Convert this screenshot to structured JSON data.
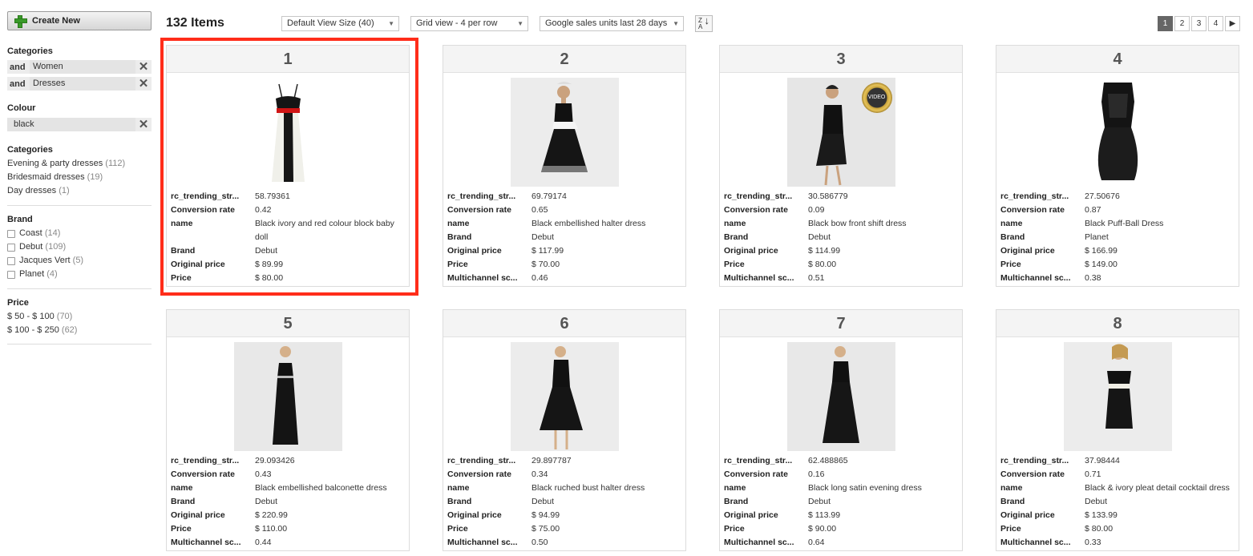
{
  "sidebar": {
    "create_label": "Create New",
    "applied_categories_title": "Categories",
    "applied_categories": [
      {
        "op": "and",
        "value": "Women"
      },
      {
        "op": "and",
        "value": "Dresses"
      }
    ],
    "colour_title": "Colour",
    "colour_value": "black",
    "categories_title": "Categories",
    "categories": [
      {
        "label": "Evening & party dresses",
        "count": "(112)"
      },
      {
        "label": "Bridesmaid dresses",
        "count": "(19)"
      },
      {
        "label": "Day dresses",
        "count": "(1)"
      }
    ],
    "brand_title": "Brand",
    "brands": [
      {
        "label": "Coast",
        "count": "(14)"
      },
      {
        "label": "Debut",
        "count": "(109)"
      },
      {
        "label": "Jacques Vert",
        "count": "(5)"
      },
      {
        "label": "Planet",
        "count": "(4)"
      }
    ],
    "price_title": "Price",
    "prices": [
      {
        "label": "$ 50 - $ 100",
        "count": "(70)"
      },
      {
        "label": "$ 100 - $ 250",
        "count": "(62)"
      }
    ]
  },
  "toolbar": {
    "items_count": "132 Items",
    "view_size": "Default View Size (40)",
    "grid_view": "Grid view - 4 per row",
    "sort_by": "Google sales units last 28 days",
    "sort_icon_top": "Z",
    "sort_icon_bottom": "A",
    "pages": [
      "1",
      "2",
      "3",
      "4"
    ],
    "next": "▶"
  },
  "products": [
    {
      "num": "1",
      "attrs": [
        {
          "k": "rc_trending_str...",
          "v": "58.79361"
        },
        {
          "k": "Conversion rate",
          "v": "0.42"
        },
        {
          "k": "name",
          "v": "Black ivory and red colour block baby doll"
        },
        {
          "k": "Brand",
          "v": "Debut"
        },
        {
          "k": "Original price",
          "v": "$ 89.99"
        },
        {
          "k": "Price",
          "v": "$ 80.00"
        }
      ]
    },
    {
      "num": "2",
      "attrs": [
        {
          "k": "rc_trending_str...",
          "v": "69.79174"
        },
        {
          "k": "Conversion rate",
          "v": "0.65"
        },
        {
          "k": "name",
          "v": "Black embellished halter dress"
        },
        {
          "k": "Brand",
          "v": "Debut"
        },
        {
          "k": "Original price",
          "v": "$ 117.99"
        },
        {
          "k": "Price",
          "v": "$ 70.00"
        },
        {
          "k": "Multichannel sc...",
          "v": "0.46"
        }
      ]
    },
    {
      "num": "3",
      "video": "VIDEO",
      "attrs": [
        {
          "k": "rc_trending_str...",
          "v": "30.586779"
        },
        {
          "k": "Conversion rate",
          "v": "0.09"
        },
        {
          "k": "name",
          "v": "Black bow front shift dress"
        },
        {
          "k": "Brand",
          "v": "Debut"
        },
        {
          "k": "Original price",
          "v": "$ 114.99"
        },
        {
          "k": "Price",
          "v": "$ 80.00"
        },
        {
          "k": "Multichannel sc...",
          "v": "0.51"
        }
      ]
    },
    {
      "num": "4",
      "attrs": [
        {
          "k": "rc_trending_str...",
          "v": "27.50676"
        },
        {
          "k": "Conversion rate",
          "v": "0.87"
        },
        {
          "k": "name",
          "v": "Black Puff-Ball Dress"
        },
        {
          "k": "Brand",
          "v": "Planet"
        },
        {
          "k": "Original price",
          "v": "$ 166.99"
        },
        {
          "k": "Price",
          "v": "$ 149.00"
        },
        {
          "k": "Multichannel sc...",
          "v": "0.38"
        }
      ]
    },
    {
      "num": "5",
      "attrs": [
        {
          "k": "rc_trending_str...",
          "v": "29.093426"
        },
        {
          "k": "Conversion rate",
          "v": "0.43"
        },
        {
          "k": "name",
          "v": "Black embellished balconette dress"
        },
        {
          "k": "Brand",
          "v": "Debut"
        },
        {
          "k": "Original price",
          "v": "$ 220.99"
        },
        {
          "k": "Price",
          "v": "$ 110.00"
        },
        {
          "k": "Multichannel sc...",
          "v": "0.44"
        }
      ]
    },
    {
      "num": "6",
      "attrs": [
        {
          "k": "rc_trending_str...",
          "v": "29.897787"
        },
        {
          "k": "Conversion rate",
          "v": "0.34"
        },
        {
          "k": "name",
          "v": "Black ruched bust halter dress"
        },
        {
          "k": "Brand",
          "v": "Debut"
        },
        {
          "k": "Original price",
          "v": "$ 94.99"
        },
        {
          "k": "Price",
          "v": "$ 75.00"
        },
        {
          "k": "Multichannel sc...",
          "v": "0.50"
        }
      ]
    },
    {
      "num": "7",
      "attrs": [
        {
          "k": "rc_trending_str...",
          "v": "62.488865"
        },
        {
          "k": "Conversion rate",
          "v": "0.16"
        },
        {
          "k": "name",
          "v": "Black long satin evening dress"
        },
        {
          "k": "Brand",
          "v": "Debut"
        },
        {
          "k": "Original price",
          "v": "$ 113.99"
        },
        {
          "k": "Price",
          "v": "$ 90.00"
        },
        {
          "k": "Multichannel sc...",
          "v": "0.64"
        }
      ]
    },
    {
      "num": "8",
      "attrs": [
        {
          "k": "rc_trending_str...",
          "v": "37.98444"
        },
        {
          "k": "Conversion rate",
          "v": "0.71"
        },
        {
          "k": "name",
          "v": "Black & ivory pleat detail cocktail dress"
        },
        {
          "k": "Brand",
          "v": "Debut"
        },
        {
          "k": "Original price",
          "v": "$ 133.99"
        },
        {
          "k": "Price",
          "v": "$ 80.00"
        },
        {
          "k": "Multichannel sc...",
          "v": "0.33"
        }
      ]
    }
  ],
  "colors": {
    "highlight": "#ff2d1a",
    "plus": "#3a9a2a"
  }
}
